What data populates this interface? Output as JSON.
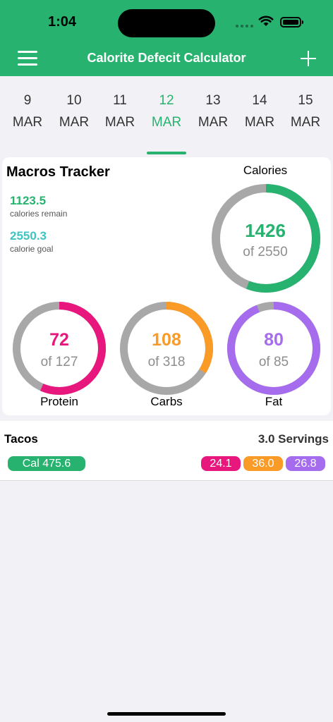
{
  "status_bar": {
    "time": "1:04"
  },
  "nav": {
    "title": "Calorite Defecit Calculator",
    "menu_icon": "hamburger-menu-icon",
    "add_icon": "plus-icon"
  },
  "dates": [
    {
      "day": "9",
      "month": "MAR",
      "selected": false
    },
    {
      "day": "10",
      "month": "MAR",
      "selected": false
    },
    {
      "day": "11",
      "month": "MAR",
      "selected": false
    },
    {
      "day": "12",
      "month": "MAR",
      "selected": true
    },
    {
      "day": "13",
      "month": "MAR",
      "selected": false
    },
    {
      "day": "14",
      "month": "MAR",
      "selected": false
    },
    {
      "day": "15",
      "month": "MAR",
      "selected": false
    }
  ],
  "tracker": {
    "title": "Macros Tracker",
    "remaining_value": "1123.5",
    "remaining_label": "calories remain",
    "goal_value": "2550.3",
    "goal_label": "calorie goal",
    "calories": {
      "label": "Calories",
      "value": "1426",
      "of": "of 2550",
      "fraction": 0.559,
      "color": "#27b36f"
    },
    "protein": {
      "label": "Protein",
      "value": "72",
      "of": "of 127",
      "fraction": 0.567,
      "color": "#e8177d"
    },
    "carbs": {
      "label": "Carbs",
      "value": "108",
      "of": "of 318",
      "fraction": 0.34,
      "color": "#fa9a27"
    },
    "fat": {
      "label": "Fat",
      "value": "80",
      "of": "of 85",
      "fraction": 0.94,
      "color": "#a66cee"
    }
  },
  "food": {
    "name": "Tacos",
    "servings": "3.0 Servings",
    "calories": "Cal 475.6",
    "protein": "24.1",
    "carbs": "36.0",
    "fat": "26.8"
  },
  "colors": {
    "brand": "#27b36f",
    "ring_track": "#a8a8a8",
    "goal_text": "#3ec4c2"
  }
}
